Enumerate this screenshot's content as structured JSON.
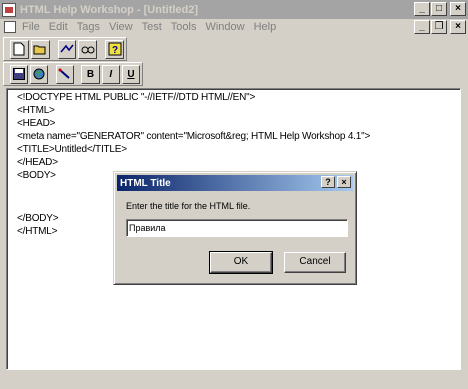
{
  "window": {
    "title": "HTML Help Workshop - [Untitled2]",
    "minimize": "_",
    "maximize": "□",
    "close": "×"
  },
  "menu": {
    "items": [
      "File",
      "Edit",
      "Tags",
      "View",
      "Test",
      "Tools",
      "Window",
      "Help"
    ],
    "mdi_minimize": "_",
    "mdi_restore": "❐",
    "mdi_close": "×"
  },
  "toolbar": {
    "bold": "B",
    "italic": "I",
    "underline": "U"
  },
  "editor": {
    "lines": [
      "<!DOCTYPE HTML PUBLIC \"-//IETF//DTD HTML//EN\">",
      "<HTML>",
      "<HEAD>",
      "<meta name=\"GENERATOR\" content=\"Microsoft&reg; HTML Help Workshop 4.1\">",
      "<TITLE>Untitled</TITLE>",
      "</HEAD>",
      "<BODY>",
      "</BODY>",
      "</HTML>"
    ]
  },
  "dialog": {
    "title": "HTML Title",
    "help": "?",
    "close": "×",
    "prompt": "Enter the title for the HTML file.",
    "value": "Правила",
    "ok": "OK",
    "cancel": "Cancel"
  }
}
